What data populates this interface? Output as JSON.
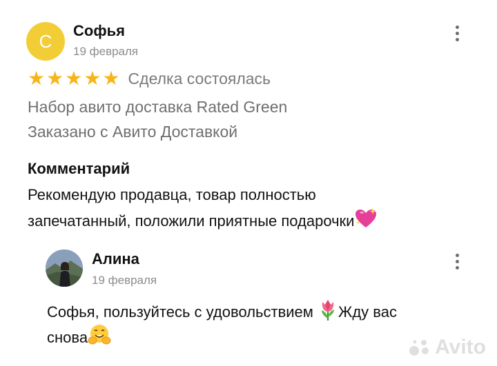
{
  "review": {
    "avatar_letter": "С",
    "author": "Софья",
    "date": "19 февраля",
    "rating": 5,
    "status": "Сделка состоялась",
    "product": "Набор авито доставка Rated Green",
    "delivery": "Заказано с Авито Доставкой",
    "comment_heading": "Комментарий",
    "comment_line1": "Рекомендую продавца, товар полностью",
    "comment_line2": "запечатанный, положили приятные подарочки"
  },
  "reply": {
    "author": "Алина",
    "date": "19 февраля",
    "text_line1a": "Софья, пользуйтесь с удовольствием ",
    "text_line1b": "Жду вас",
    "text_line2": "снова"
  },
  "watermark": "Avito",
  "colors": {
    "avatar_bg": "#f2cd35",
    "star": "#f7b51c",
    "muted_text": "#6f6f6f",
    "date_text": "#8c8c8c"
  },
  "icons": [
    "more-vertical-icon",
    "star-icon",
    "sparkling-heart-emoji",
    "tulip-emoji",
    "hugging-face-emoji",
    "avito-logo"
  ]
}
